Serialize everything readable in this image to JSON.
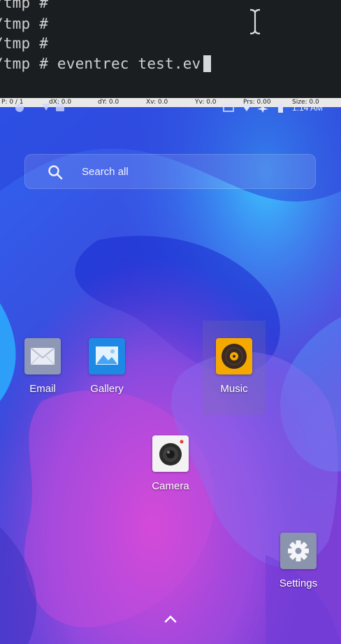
{
  "terminal": {
    "lines": [
      "/tmp #",
      "/tmp #",
      "/tmp #",
      "/tmp # eventrec test.ev"
    ]
  },
  "pointer_overlay": {
    "p": "P: 0 / 1",
    "dx": "dX: 0.0",
    "dy": "dY: 0.0",
    "xv": "Xv: 0.0",
    "yv": "Yv: 0.0",
    "prs": "Prs: 0.00",
    "size": "Size: 0.0"
  },
  "status_bar": {
    "time": "1:14 AM"
  },
  "search": {
    "label": "Search all"
  },
  "apps": {
    "email": "Email",
    "gallery": "Gallery",
    "music": "Music",
    "camera": "Camera",
    "settings": "Settings"
  },
  "colors": {
    "terminal_bg": "#1b1e21",
    "gallery_blue": "#1e88e5",
    "music_orange": "#f5a800",
    "settings_gray": "#8b94ad"
  }
}
